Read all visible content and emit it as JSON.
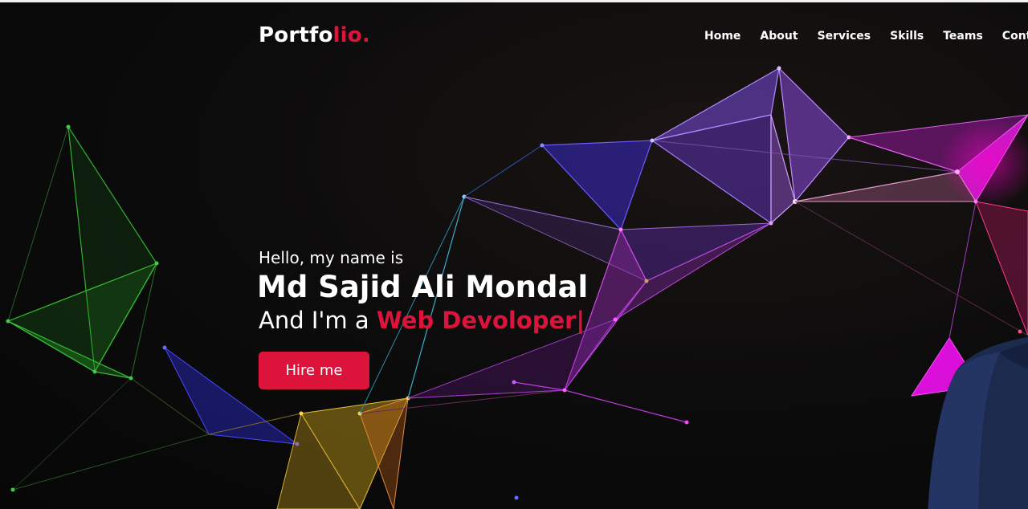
{
  "brand": {
    "logo_main": "Portfo",
    "logo_accent": "lio."
  },
  "nav": {
    "items": [
      {
        "label": "Home"
      },
      {
        "label": "About"
      },
      {
        "label": "Services"
      },
      {
        "label": "Skills"
      },
      {
        "label": "Teams"
      },
      {
        "label": "Contact"
      }
    ]
  },
  "hero": {
    "greeting": "Hello, my name is",
    "name": "Md Sajid Ali Mondal",
    "role_prefix": "And I'm a",
    "role_typed": "Web Devoloper|",
    "cta_label": "Hire me"
  },
  "colors": {
    "accent": "#dc143c",
    "background": "#0b0b0b",
    "text": "#ffffff"
  }
}
